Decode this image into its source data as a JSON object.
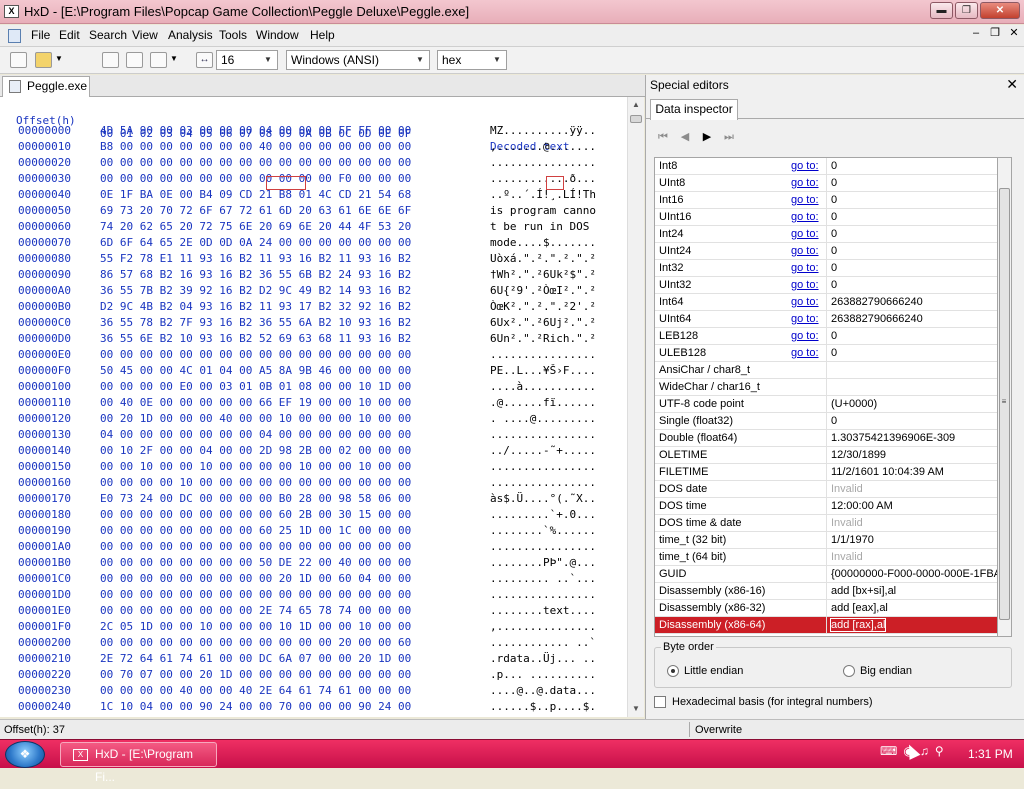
{
  "window": {
    "app_icon": "hxd-logo",
    "title": "HxD - [E:\\Program Files\\Popcap Game Collection\\Peggle Deluxe\\Peggle.exe]",
    "buttons": [
      "minimize-icon",
      "restore-icon",
      "close-icon"
    ]
  },
  "menu": {
    "items": [
      "File",
      "Edit",
      "Search",
      "View",
      "Analysis",
      "Tools",
      "Window",
      "Help"
    ]
  },
  "toolbar": {
    "bytes_per_row": "16",
    "charset": "Windows (ANSI)",
    "offset_base": "hex"
  },
  "file_tab": {
    "label": "Peggle.exe"
  },
  "hex_view": {
    "header_offset": "Offset(h)",
    "header_columns": "00 01 02 03 04 05 06 07 08 09 0A 0B 0C 0D 0E 0F",
    "header_decoded": "Decoded text",
    "rows": [
      {
        "off": "00000000",
        "hex": "4D 5A 90 00 03 00 00 00 04 00 00 00 FF FF 00 00",
        "txt": "MZ..........ÿÿ.."
      },
      {
        "off": "00000010",
        "hex": "B8 00 00 00 00 00 00 00 40 00 00 00 00 00 00 00",
        "txt": ",.......@......."
      },
      {
        "off": "00000020",
        "hex": "00 00 00 00 00 00 00 00 00 00 00 00 00 00 00 00",
        "txt": "................"
      },
      {
        "off": "00000030",
        "hex": "00 00 00 00 00 00 00 00 00 00 00 00 F0 00 00 00",
        "txt": "............ð..."
      },
      {
        "off": "00000040",
        "hex": "0E 1F BA 0E 00 B4 09 CD 21 B8 01 4C CD 21 54 68",
        "txt": "..º..´.Í!¸.LÍ!Th"
      },
      {
        "off": "00000050",
        "hex": "69 73 20 70 72 6F 67 72 61 6D 20 63 61 6E 6E 6F",
        "txt": "is program canno"
      },
      {
        "off": "00000060",
        "hex": "74 20 62 65 20 72 75 6E 20 69 6E 20 44 4F 53 20",
        "txt": "t be run in DOS "
      },
      {
        "off": "00000070",
        "hex": "6D 6F 64 65 2E 0D 0D 0A 24 00 00 00 00 00 00 00",
        "txt": "mode....$......."
      },
      {
        "off": "00000080",
        "hex": "55 F2 78 E1 11 93 16 B2 11 93 16 B2 11 93 16 B2",
        "txt": "Uòxá.\".².\".².\".²"
      },
      {
        "off": "00000090",
        "hex": "86 57 68 B2 16 93 16 B2 36 55 6B B2 24 93 16 B2",
        "txt": "†Wh².\".²6Uk²$\".²"
      },
      {
        "off": "000000A0",
        "hex": "36 55 7B B2 39 92 16 B2 D2 9C 49 B2 14 93 16 B2",
        "txt": "6U{²9'.²ÒœI².\".²"
      },
      {
        "off": "000000B0",
        "hex": "D2 9C 4B B2 04 93 16 B2 11 93 17 B2 32 92 16 B2",
        "txt": "ÒœK².\".².\".²2'.²"
      },
      {
        "off": "000000C0",
        "hex": "36 55 78 B2 7F 93 16 B2 36 55 6A B2 10 93 16 B2",
        "txt": "6Ux².\".²6Uj².\".²"
      },
      {
        "off": "000000D0",
        "hex": "36 55 6E B2 10 93 16 B2 52 69 63 68 11 93 16 B2",
        "txt": "6Un².\".²Rich.\".²"
      },
      {
        "off": "000000E0",
        "hex": "00 00 00 00 00 00 00 00 00 00 00 00 00 00 00 00",
        "txt": "................"
      },
      {
        "off": "000000F0",
        "hex": "50 45 00 00 4C 01 04 00 A5 8A 9B 46 00 00 00 00",
        "txt": "PE..L...¥Š›F...."
      },
      {
        "off": "00000100",
        "hex": "00 00 00 00 E0 00 03 01 0B 01 08 00 00 10 1D 00",
        "txt": "....à..........."
      },
      {
        "off": "00000110",
        "hex": "00 40 0E 00 00 00 00 00 66 EF 19 00 00 10 00 00",
        "txt": ".@......fï......"
      },
      {
        "off": "00000120",
        "hex": "00 20 1D 00 00 00 40 00 00 10 00 00 00 10 00 00",
        "txt": ". ....@........."
      },
      {
        "off": "00000130",
        "hex": "04 00 00 00 00 00 00 00 04 00 00 00 00 00 00 00",
        "txt": "................"
      },
      {
        "off": "00000140",
        "hex": "00 10 2F 00 00 04 00 00 2D 98 2B 00 02 00 00 00",
        "txt": "../.....-˜+....."
      },
      {
        "off": "00000150",
        "hex": "00 00 10 00 00 10 00 00 00 00 10 00 00 10 00 00",
        "txt": "................"
      },
      {
        "off": "00000160",
        "hex": "00 00 00 00 10 00 00 00 00 00 00 00 00 00 00 00",
        "txt": "................"
      },
      {
        "off": "00000170",
        "hex": "E0 73 24 00 DC 00 00 00 00 B0 28 00 98 58 06 00",
        "txt": "às$.Ü....°(.˜X.."
      },
      {
        "off": "00000180",
        "hex": "00 00 00 00 00 00 00 00 00 60 2B 00 30 15 00 00",
        "txt": ".........`+.0..."
      },
      {
        "off": "00000190",
        "hex": "00 00 00 00 00 00 00 00 60 25 1D 00 1C 00 00 00",
        "txt": "........`%......"
      },
      {
        "off": "000001A0",
        "hex": "00 00 00 00 00 00 00 00 00 00 00 00 00 00 00 00",
        "txt": "................"
      },
      {
        "off": "000001B0",
        "hex": "00 00 00 00 00 00 00 00 50 DE 22 00 40 00 00 00",
        "txt": "........PÞ\".@..."
      },
      {
        "off": "000001C0",
        "hex": "00 00 00 00 00 00 00 00 00 20 1D 00 60 04 00 00",
        "txt": "......... ..`..."
      },
      {
        "off": "000001D0",
        "hex": "00 00 00 00 00 00 00 00 00 00 00 00 00 00 00 00",
        "txt": "................"
      },
      {
        "off": "000001E0",
        "hex": "00 00 00 00 00 00 00 00 2E 74 65 78 74 00 00 00",
        "txt": "........text...."
      },
      {
        "off": "000001F0",
        "hex": "2C 05 1D 00 00 10 00 00 00 10 1D 00 00 10 00 00",
        "txt": ",..............."
      },
      {
        "off": "00000200",
        "hex": "00 00 00 00 00 00 00 00 00 00 00 00 20 00 00 60",
        "txt": "............ ..`"
      },
      {
        "off": "00000210",
        "hex": "2E 72 64 61 74 61 00 00 DC 6A 07 00 00 20 1D 00",
        "txt": ".rdata..Üj... .."
      },
      {
        "off": "00000220",
        "hex": "00 70 07 00 00 20 1D 00 00 00 00 00 00 00 00 00",
        "txt": ".p... .........."
      },
      {
        "off": "00000230",
        "hex": "00 00 00 00 40 00 00 40 2E 64 61 74 61 00 00 00",
        "txt": "....@..@.data..."
      },
      {
        "off": "00000240",
        "hex": "1C 10 04 00 00 90 24 00 00 70 00 00 00 90 24 00",
        "txt": "......$..p....$."
      }
    ]
  },
  "special_editors": {
    "title": "Special editors",
    "tab": "Data inspector",
    "nav_icons": [
      "first-icon",
      "previous-icon",
      "next-icon",
      "last-icon"
    ],
    "goto_label": "go to:",
    "rows": [
      {
        "name": "Int8",
        "goto": true,
        "value": "0",
        "grey": false
      },
      {
        "name": "UInt8",
        "goto": true,
        "value": "0",
        "grey": false
      },
      {
        "name": "Int16",
        "goto": true,
        "value": "0",
        "grey": false
      },
      {
        "name": "UInt16",
        "goto": true,
        "value": "0",
        "grey": false
      },
      {
        "name": "Int24",
        "goto": true,
        "value": "0",
        "grey": false
      },
      {
        "name": "UInt24",
        "goto": true,
        "value": "0",
        "grey": false
      },
      {
        "name": "Int32",
        "goto": true,
        "value": "0",
        "grey": false
      },
      {
        "name": "UInt32",
        "goto": true,
        "value": "0",
        "grey": false
      },
      {
        "name": "Int64",
        "goto": true,
        "value": "263882790666240",
        "grey": false
      },
      {
        "name": "UInt64",
        "goto": true,
        "value": "263882790666240",
        "grey": false
      },
      {
        "name": "LEB128",
        "goto": true,
        "value": "0",
        "grey": false
      },
      {
        "name": "ULEB128",
        "goto": true,
        "value": "0",
        "grey": false
      },
      {
        "name": "AnsiChar / char8_t",
        "goto": false,
        "value": "",
        "grey": false
      },
      {
        "name": "WideChar / char16_t",
        "goto": false,
        "value": "",
        "grey": false
      },
      {
        "name": "UTF-8 code point",
        "goto": false,
        "value": "   (U+0000)",
        "grey": false
      },
      {
        "name": "Single (float32)",
        "goto": false,
        "value": "0",
        "grey": false
      },
      {
        "name": "Double (float64)",
        "goto": false,
        "value": "1.30375421396906E-309",
        "grey": false
      },
      {
        "name": "OLETIME",
        "goto": false,
        "value": "12/30/1899",
        "grey": false
      },
      {
        "name": "FILETIME",
        "goto": false,
        "value": "11/2/1601 10:04:39 AM",
        "grey": false
      },
      {
        "name": "DOS date",
        "goto": false,
        "value": "Invalid",
        "grey": true
      },
      {
        "name": "DOS time",
        "goto": false,
        "value": "12:00:00 AM",
        "grey": false
      },
      {
        "name": "DOS time & date",
        "goto": false,
        "value": "Invalid",
        "grey": true
      },
      {
        "name": "time_t (32 bit)",
        "goto": false,
        "value": "1/1/1970",
        "grey": false
      },
      {
        "name": "time_t (64 bit)",
        "goto": false,
        "value": "Invalid",
        "grey": true
      },
      {
        "name": "GUID",
        "goto": false,
        "value": "{00000000-F000-0000-000E-1FBA",
        "grey": false
      },
      {
        "name": "Disassembly (x86-16)",
        "goto": false,
        "value": "add [bx+si],al",
        "grey": false
      },
      {
        "name": "Disassembly (x86-32)",
        "goto": false,
        "value": "add [eax],al",
        "grey": false
      },
      {
        "name": "Disassembly (x86-64)",
        "goto": false,
        "value": "add [rax],al",
        "grey": false,
        "selected": true
      }
    ],
    "byte_order": {
      "legend": "Byte order",
      "little": "Little endian",
      "big": "Big endian",
      "selected": "little"
    },
    "hex_basis_label": "Hexadecimal basis (for integral numbers)"
  },
  "status": {
    "offset": "Offset(h): 37",
    "mode": "Overwrite"
  },
  "taskbar": {
    "start_icon": "windows-orb",
    "task_label": "HxD - [E:\\Program Fi...",
    "clock": "1:31 PM"
  },
  "colors": {
    "hex_blue": "#1a35c0",
    "selection_red": "#cc1f26",
    "taskbar_pink": "#e01f57"
  }
}
